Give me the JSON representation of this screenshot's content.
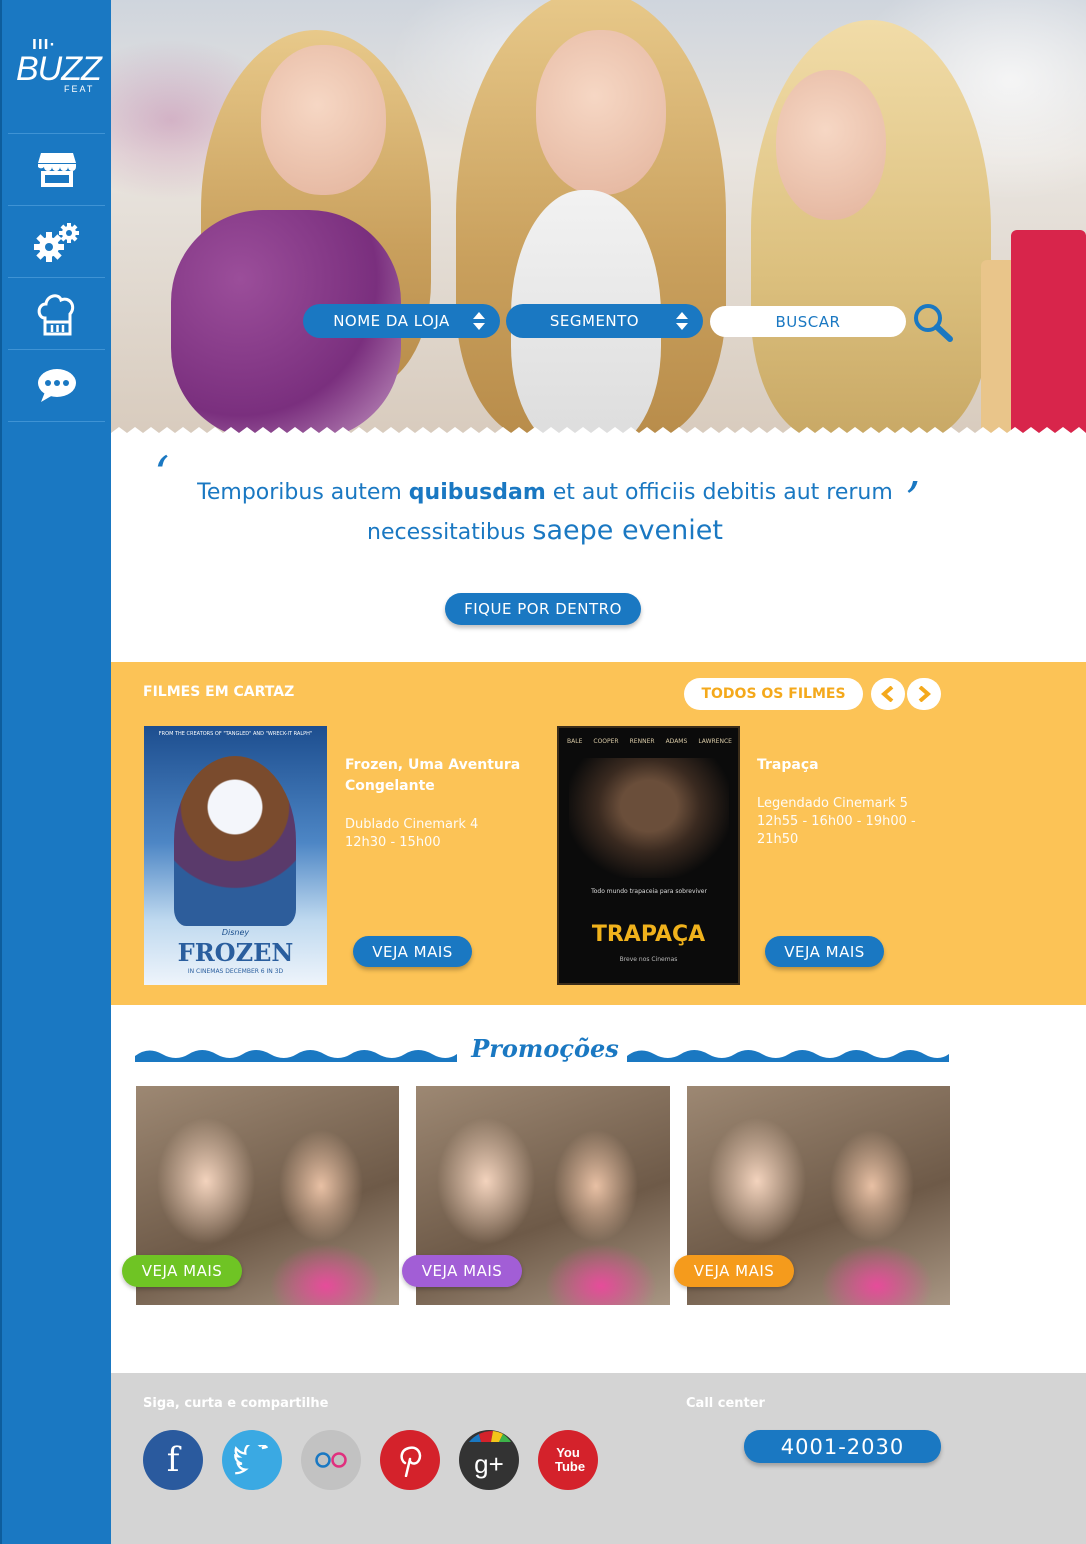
{
  "brand": {
    "bars": "III·",
    "word": "BUZZ",
    "sub": "FEAT"
  },
  "sidebar": {
    "items": [
      {
        "icon": "store-icon"
      },
      {
        "icon": "gears-icon"
      },
      {
        "icon": "chef-hat-icon"
      },
      {
        "icon": "chat-bubble-icon"
      }
    ]
  },
  "search": {
    "store_label": "NOME DA LOJA",
    "segment_label": "SEGMENTO",
    "search_label": "BUSCAR"
  },
  "quote": {
    "part1": "Temporibus autem ",
    "bold": "quibusdam",
    "part2": " et aut officiis debitis aut rerum",
    "part3": "necessitatibus ",
    "big": "saepe eveniet",
    "button": "FIQUE POR DENTRO"
  },
  "movies": {
    "title": "FILMES EM CARTAZ",
    "all_button": "TODOS OS FILMES",
    "items": [
      {
        "poster_top": "FROM THE CREATORS OF \"TANGLED\" AND \"WRECK-IT RALPH\"",
        "poster_brand": "Disney",
        "poster_title": "FROZEN",
        "poster_bottom": "IN CINEMAS DECEMBER 6 IN 3D",
        "name": "Frozen, Uma Aventura Congelante",
        "info1": "Dublado Cinemark 4",
        "info2": "12h30 - 15h00",
        "button": "VEJA MAIS"
      },
      {
        "poster_cast": [
          "BALE",
          "COOPER",
          "RENNER",
          "ADAMS",
          "LAWRENCE"
        ],
        "poster_tagline": "Todo mundo trapaceia para sobreviver",
        "poster_title": "TRAPAÇA",
        "poster_bottom": "Breve nos Cinemas",
        "name": "Trapaça",
        "info1": "Legendado Cinemark 5",
        "info2": "12h55 - 16h00 - 19h00 - 21h50",
        "button": "VEJA MAIS"
      }
    ]
  },
  "promotions": {
    "title": "Promoções",
    "items": [
      {
        "button": "VEJA MAIS",
        "color": "#6fc424"
      },
      {
        "button": "VEJA MAIS",
        "color": "#a25ed6"
      },
      {
        "button": "VEJA MAIS",
        "color": "#f59b1c"
      }
    ]
  },
  "footer": {
    "social_label": "Siga, curta e compartilhe",
    "call_label": "Call center",
    "phone": "4001-2030",
    "social": [
      {
        "name": "facebook-icon",
        "glyph": "f",
        "color": "#2a5a9e"
      },
      {
        "name": "twitter-icon",
        "glyph": "",
        "color": "#3aa9e3"
      },
      {
        "name": "flickr-icon",
        "glyph": "",
        "color": "#c2c2c2"
      },
      {
        "name": "pinterest-icon",
        "glyph": "",
        "color": "#d4222b"
      },
      {
        "name": "google-plus-icon",
        "glyph": "g+",
        "color": "#333333"
      },
      {
        "name": "youtube-icon",
        "glyph": "You Tube",
        "color": "#d4222b"
      }
    ]
  }
}
